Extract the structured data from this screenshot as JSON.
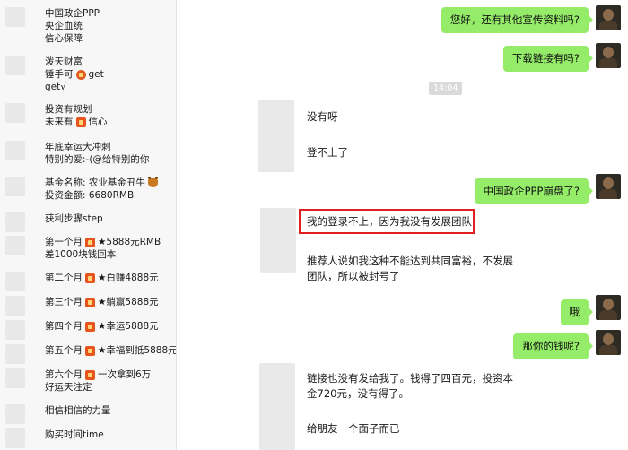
{
  "left_panel": {
    "entries": [
      {
        "lines": [
          "中国政企PPP",
          "央企血统",
          "信心保障"
        ]
      },
      {
        "lines": [
          "泼天财富",
          "锤手可|get",
          "get√"
        ]
      },
      {
        "lines": [
          "投资有规划",
          "未来有|信心"
        ]
      },
      {
        "lines": [
          "年底幸运大冲刺",
          "特别的爱:-(@给特别的你"
        ]
      },
      {
        "lines": [
          "基金名称: 农业基金丑牛",
          "投资金额: 6680RMB"
        ]
      },
      {
        "lines": [
          "获利步骤step"
        ]
      },
      {
        "lines": [
          "第一个月|★5888元RMB",
          "差1000块钱回本"
        ]
      },
      {
        "lines": [
          "第二个月|★白赚4888元"
        ]
      },
      {
        "lines": [
          "第三个月|★躺赢5888元"
        ]
      },
      {
        "lines": [
          "第四个月|★幸运5888元"
        ]
      },
      {
        "lines": [
          "第五个月|★幸福到抵5888元"
        ]
      },
      {
        "lines": [
          "第六个月|一次拿到6万",
          "好运天注定"
        ]
      },
      {
        "lines": [
          "相信相信的力量"
        ]
      },
      {
        "lines": [
          "购买时间time"
        ]
      }
    ]
  },
  "chat": {
    "messages": [
      {
        "side": "right",
        "text": "您好，还有其他宣传资料吗?"
      },
      {
        "side": "right",
        "text": "下载链接有吗?"
      },
      {
        "side": "time",
        "text": "14:04"
      },
      {
        "side": "left",
        "text": "没有呀"
      },
      {
        "side": "left",
        "text": "登不上了"
      },
      {
        "side": "right",
        "text": "中国政企PPP崩盘了?"
      },
      {
        "side": "left",
        "text": "我的登录不上，因为我没有发展团队"
      },
      {
        "side": "left",
        "text": "推荐人说如我这种不能达到共同富裕，不发展团队，所以被封号了"
      },
      {
        "side": "right",
        "text": "哦"
      },
      {
        "side": "right",
        "text": "那你的钱呢?"
      },
      {
        "side": "left",
        "text": "链接也没有发给我了。钱得了四百元，投资本金720元，没有得了。"
      },
      {
        "side": "left",
        "text": "给朋友一个面子而已"
      }
    ]
  }
}
